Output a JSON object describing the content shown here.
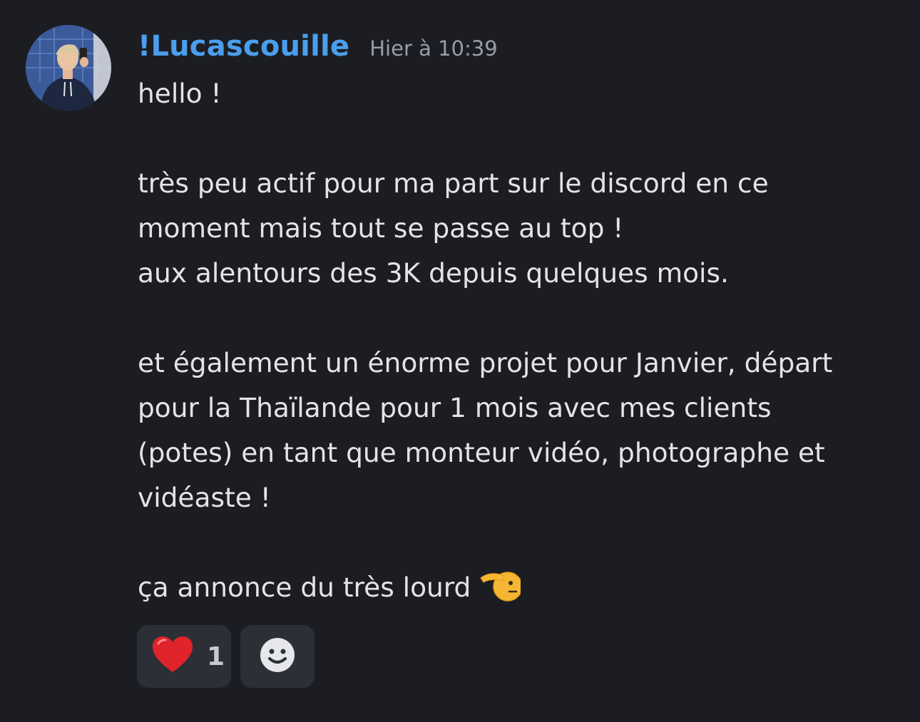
{
  "message": {
    "author": "!Lucascouille",
    "timestamp": "Hier à 10:39",
    "lines": {
      "l1": "hello !",
      "l2": "très peu actif pour ma part sur le discord en ce",
      "l3": "moment mais tout se passe au top !",
      "l4": "aux alentours des 3K depuis quelques mois.",
      "l5": "et également un énorme projet pour Janvier, départ",
      "l6": "pour la Thaïlande pour 1 mois avec mes clients",
      "l7": "(potes) en tant que monteur vidéo, photographe et",
      "l8": "vidéaste !",
      "l9": "ça annonce du très lourd"
    },
    "inline_emoji": "saluting-face-icon"
  },
  "reactions": [
    {
      "icon": "red-heart-icon",
      "count": "1"
    },
    {
      "icon": "add-reaction-smiley-icon"
    }
  ],
  "colors": {
    "background": "#1c1d22",
    "username": "#4a9eed",
    "timestamp": "#9a9ca6",
    "text": "#e3e4e8",
    "reaction_bg": "#2d2f37"
  }
}
